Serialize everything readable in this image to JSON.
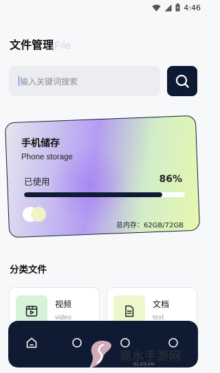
{
  "status_bar": {
    "time": "4:46",
    "icons": [
      "wifi-icon",
      "signal-icon",
      "battery-icon"
    ]
  },
  "header": {
    "title": "文件管理",
    "title_en": "File"
  },
  "search": {
    "placeholder": "输入关键词搜索",
    "button_icon": "search-icon"
  },
  "storage": {
    "title": "手机储存",
    "subtitle": "Phone storage",
    "used_label": "已使用",
    "used_percent_text": "86%",
    "used_fraction": 0.86,
    "total_text": "总内存：62GB/72GB"
  },
  "categories": {
    "title": "分类文件",
    "items": [
      {
        "name": "视频",
        "name_en": "video",
        "icon": "video-icon"
      },
      {
        "name": "文档",
        "name_en": "text",
        "icon": "document-icon"
      }
    ]
  },
  "bottom_nav": {
    "items": [
      {
        "icon": "home-icon"
      },
      {
        "icon": "nav-icon-2"
      },
      {
        "icon": "nav-icon-3"
      },
      {
        "icon": "nav-icon-4"
      }
    ]
  },
  "watermark": {
    "text": "商水手游网",
    "slogan": "SLOGAN"
  },
  "colors": {
    "primary": "#0f1a33",
    "background": "#f7f8fa",
    "search_bg": "#ecedf0",
    "video_icon_bg": "#d6f2d9",
    "doc_icon_bg": "#edf7cc"
  }
}
